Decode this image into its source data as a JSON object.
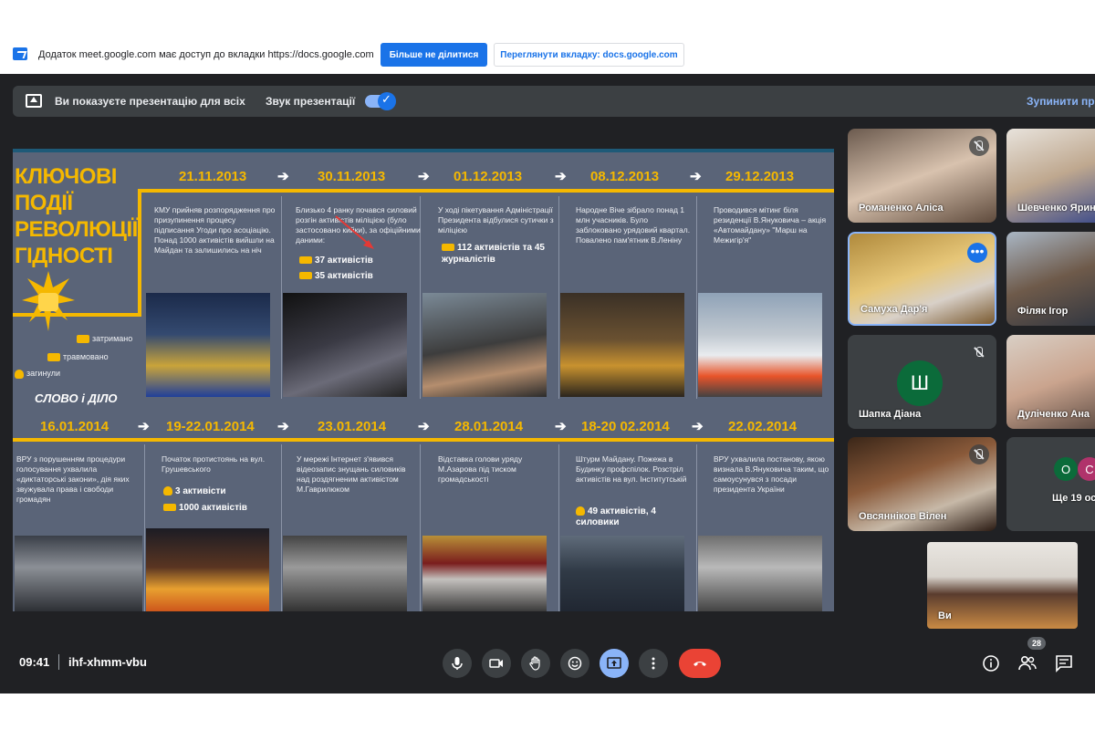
{
  "infobar": {
    "message": "Додаток meet.google.com має доступ до вкладки https://docs.google.com",
    "stop_sharing": "Більше не ділитися",
    "view_tab": "Переглянути вкладку: docs.google.com"
  },
  "present_bar": {
    "message": "Ви показуєте презентацію для всіх",
    "sound_label": "Звук презентації",
    "sound_on": true,
    "stop_label": "Зупинити пре"
  },
  "slide": {
    "title": "КЛЮЧОВІ ПОДІЇ РЕВОЛЮЦІЇ ГІДНОСТІ",
    "legend": {
      "detained": "затримано",
      "injured": "травмовано",
      "killed": "загинули"
    },
    "logo": "СЛОВО і ДІЛО",
    "row1": [
      {
        "date": "21.11.2013",
        "text": "КМУ прийняв розпорядження про призупинення процесу підписання Угоди про асоціацію. Понад 1000 активістів вийшли на Майдан та залишились на ніч",
        "stats": []
      },
      {
        "date": "30.11.2013",
        "text": "Близько 4 ранку почався силовий розгін активістів міліцією (було застосовано кийки), за офіційними даними:",
        "stats": [
          "37 активістів",
          "35 активістів"
        ]
      },
      {
        "date": "01.12.2013",
        "text": "У ході пікетування Адміністрації Президента відбулися сутички з міліцією",
        "stats": [
          "112 активістів та 45 журналістів"
        ]
      },
      {
        "date": "08.12.2013",
        "text": "Народне Віче зібрало понад 1 млн учасників. Було заблоковано урядовий квартал. Повалено пам'ятник В.Леніну",
        "stats": []
      },
      {
        "date": "29.12.2013",
        "text": "Проводився мітинг біля резиденції В.Януковича – акція «Автомайдану» \"Марш на Межигір'я\"",
        "stats": []
      }
    ],
    "row2": [
      {
        "date": "16.01.2014",
        "text": "ВРУ з порушенням процедури голосування ухвалила «диктаторські закони», дія яких звужувала права і свободи громадян",
        "stats": []
      },
      {
        "date": "19-22.01.2014",
        "text": "Початок протистоянь на вул. Грушевського",
        "stats": [
          "3 активісти",
          "1000 активістів"
        ]
      },
      {
        "date": "23.01.2014",
        "text": "У мережі Інтернет з'явився відеозапис знущань силовиків над роздягненим активістом М.Гаврилюком",
        "stats": []
      },
      {
        "date": "28.01.2014",
        "text": "Відставка голови уряду М.Азарова під тиском громадськості",
        "stats": []
      },
      {
        "date": "18-20 02.2014",
        "text": "Штурм Майдану. Пожежа в Будинку профспілок. Розстріл активістів на вул. Інститутській",
        "stats": [
          "49 активістів, 4 силовики"
        ]
      },
      {
        "date": "22.02.2014",
        "text": "ВРУ ухвалила постанову, якою визнала В.Януковича таким, що самоусунувся з посади президента України",
        "stats": []
      }
    ]
  },
  "participants": [
    {
      "name": "Романенко Аліса",
      "muted": true
    },
    {
      "name": "Шевченко Ярина",
      "muted": false
    },
    {
      "name": "Самуха Дар'я",
      "muted": false,
      "active": true
    },
    {
      "name": "Філяк Ігор",
      "muted": false
    },
    {
      "name": "Шапка Діана",
      "muted": true,
      "initial": "Ш"
    },
    {
      "name": "Дуліченко Ана",
      "muted": false
    },
    {
      "name": "Овсянніков Вілен",
      "muted": true
    },
    {
      "name": "Ще 19 ос",
      "initials": [
        "О",
        "С"
      ]
    }
  ],
  "self_view": {
    "name": "Ви"
  },
  "controls": {
    "time": "09:41",
    "meeting_code": "ihf-xhmm-vbu",
    "participants_count": "28"
  },
  "colors": {
    "accent": "#1a73e8",
    "slide_yellow": "#f5b800",
    "end_call": "#ea4335",
    "meet_bg": "#202124"
  }
}
